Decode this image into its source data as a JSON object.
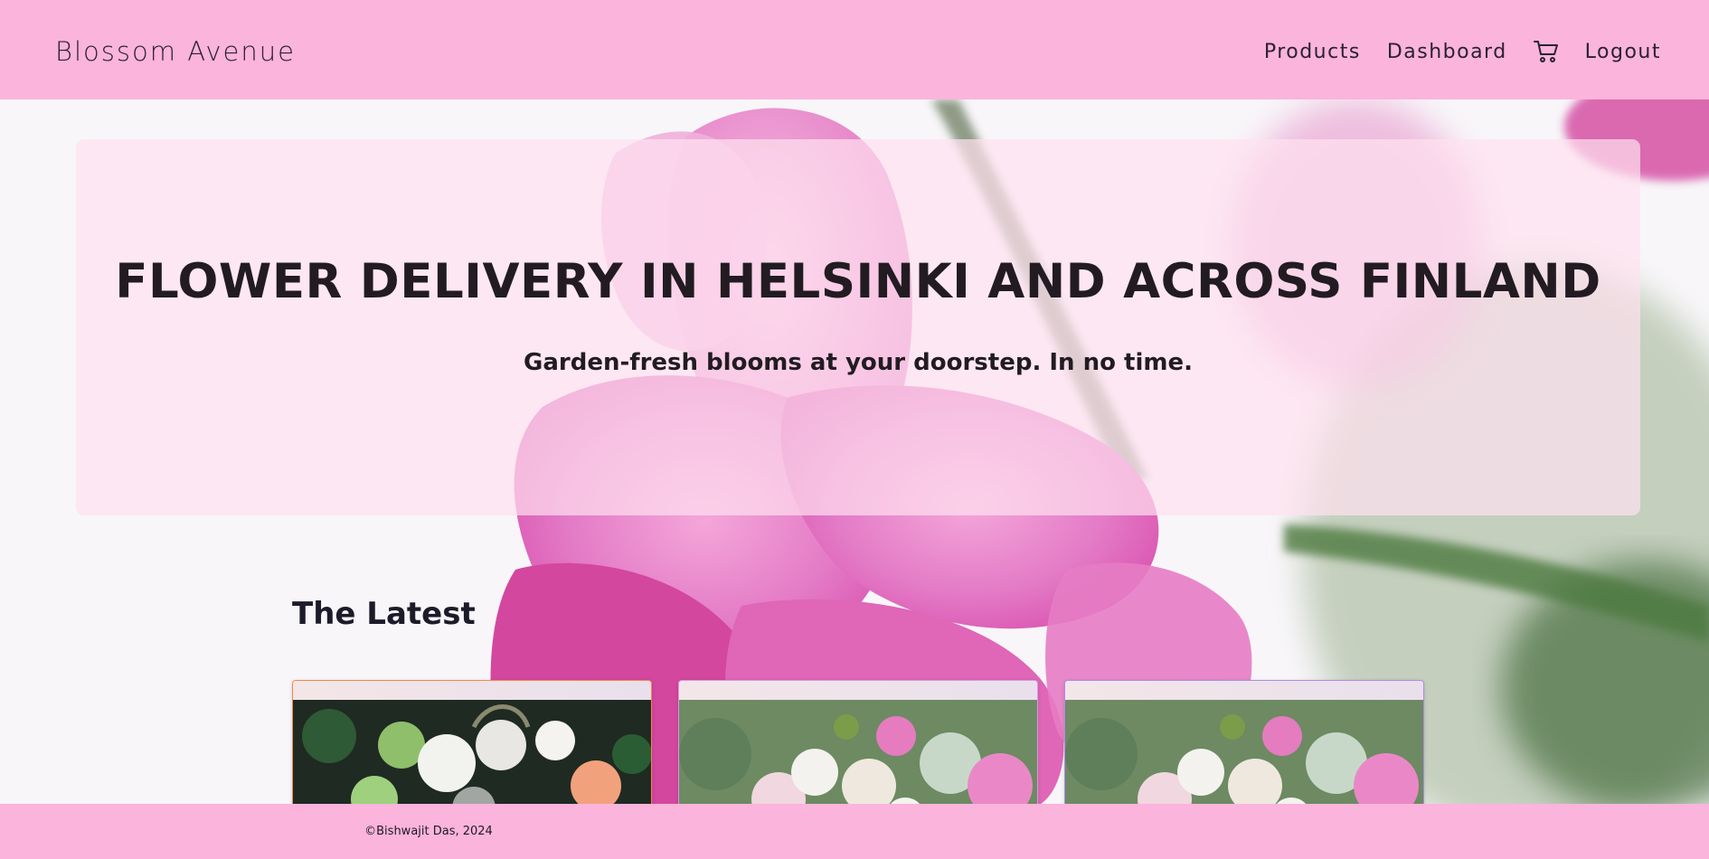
{
  "navbar": {
    "brand": "Blossom Avenue",
    "links": {
      "products": "Products",
      "dashboard": "Dashboard",
      "logout": "Logout"
    },
    "cart_icon": "shopping-cart-icon"
  },
  "hero": {
    "title": "FLOWER DELIVERY IN HELSINKI AND ACROSS FINLAND",
    "subtitle": "Garden-fresh blooms at your doorstep. In no time."
  },
  "latest": {
    "heading": "The Latest"
  },
  "footer": {
    "copyright": "©Bishwajit Das, 2024"
  },
  "colors": {
    "navbar_bg": "#fbb4dc",
    "hero_overlay": "#ffe1f0",
    "text_dark": "#221c22",
    "flower_pink": "#e65fb8"
  }
}
